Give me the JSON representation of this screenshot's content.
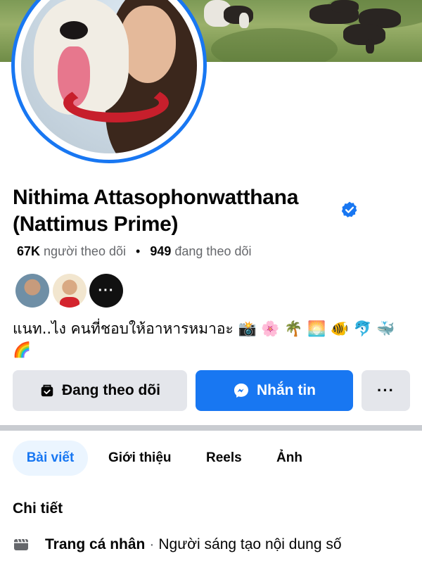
{
  "profile": {
    "name": "Nithima Attasophonwatthana (Nattimus Prime)",
    "verified_icon": "verified-badge-icon",
    "followers_count": "67K",
    "followers_label": "người theo dõi",
    "following_count": "949",
    "following_label": "đang theo dõi",
    "stats_separator": "•",
    "mutual_more_label": "···",
    "bio": "แนท..ไง คนที่ชอบให้อาหารหมาอะ 📸 🌸 🌴 🌅 🐠 🐬 🐳 🌈"
  },
  "actions": {
    "following_label": "Đang theo dõi",
    "message_label": "Nhắn tin",
    "more_label": "···"
  },
  "tabs": [
    {
      "label": "Bài viết",
      "active": true
    },
    {
      "label": "Giới thiệu",
      "active": false
    },
    {
      "label": "Reels",
      "active": false
    },
    {
      "label": "Ảnh",
      "active": false
    }
  ],
  "details": {
    "title": "Chi tiết",
    "item_type": "Trang cá nhân",
    "item_separator": "·",
    "item_value": "Người sáng tạo nội dung số"
  },
  "colors": {
    "accent": "#1877f2",
    "button_gray": "#e4e6eb",
    "tab_active_bg": "#ebf5ff",
    "secondary_text": "#65676b"
  }
}
